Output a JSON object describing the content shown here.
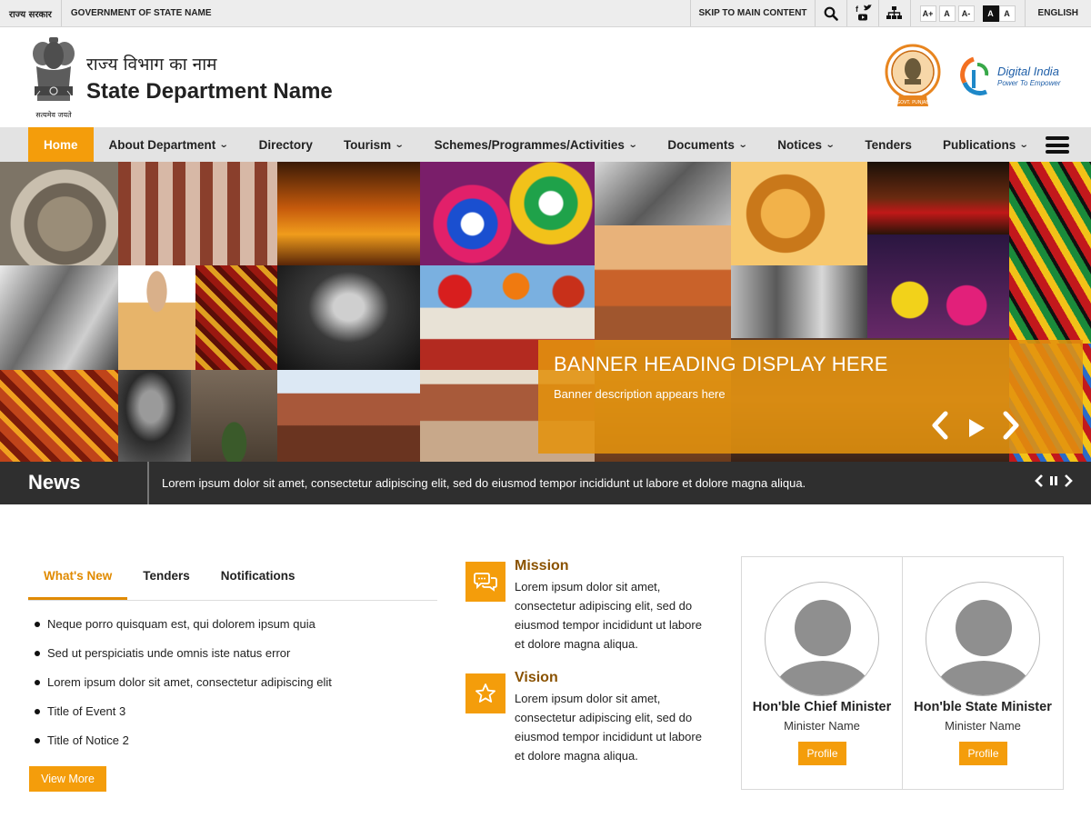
{
  "topbar": {
    "gov_hindi": "राज्य सरकार",
    "gov_name": "GOVERNMENT OF STATE NAME",
    "skip": "SKIP TO MAIN CONTENT",
    "font_sizes": [
      "A+",
      "A",
      "A-"
    ],
    "contrast": [
      "A",
      "A"
    ],
    "language": "ENGLISH",
    "social_icons": [
      "facebook-icon",
      "twitter-icon",
      "youtube-icon"
    ]
  },
  "header": {
    "emblem_caption": "सत्यमेव जयते",
    "dept_hindi": "राज्य विभाग का नाम",
    "dept_name": "State Department Name",
    "seal_caption": "GOVT. PUNJAB",
    "digital_india_title": "Digital India",
    "digital_india_tagline": "Power To Empower"
  },
  "nav": {
    "items": [
      {
        "label": "Home",
        "active": true,
        "dropdown": false
      },
      {
        "label": "About Department",
        "dropdown": true
      },
      {
        "label": "Directory",
        "dropdown": false
      },
      {
        "label": "Tourism",
        "dropdown": true
      },
      {
        "label": "Schemes/Programmes/Activities",
        "dropdown": true
      },
      {
        "label": "Documents",
        "dropdown": true
      },
      {
        "label": "Notices",
        "dropdown": true
      },
      {
        "label": "Tenders",
        "dropdown": false
      },
      {
        "label": "Publications",
        "dropdown": true
      }
    ]
  },
  "banner": {
    "heading": "BANNER HEADING DISPLAY HERE",
    "description": "Banner description appears here"
  },
  "news": {
    "label": "News",
    "ticker": "Lorem ipsum dolor sit amet, consectetur adipiscing elit, sed do eiusmod tempor incididunt ut labore et dolore magna aliqua."
  },
  "tabs": {
    "items": [
      "What's New",
      "Tenders",
      "Notifications"
    ],
    "list": [
      "Neque porro quisquam est, qui dolorem ipsum quia",
      "Sed ut perspiciatis unde omnis iste natus error",
      "Lorem ipsum dolor sit amet, consectetur adipiscing elit",
      "Title of Event 3",
      "Title of Notice 2"
    ],
    "view_more": "View More"
  },
  "mission": {
    "title": "Mission",
    "text": "Lorem ipsum dolor sit amet, consectetur adipiscing elit, sed do eiusmod tempor incididunt ut labore et dolore magna aliqua."
  },
  "vision": {
    "title": "Vision",
    "text": "Lorem ipsum dolor sit amet, consectetur adipiscing elit, sed do eiusmod tempor incididunt ut labore et dolore magna aliqua."
  },
  "ministers": [
    {
      "role": "Hon'ble Chief Minister",
      "name": "Minister Name",
      "button": "Profile"
    },
    {
      "role": "Hon'ble State Minister",
      "name": "Minister Name",
      "button": "Profile"
    }
  ],
  "colors": {
    "accent": "#f49d0b",
    "banner_overlay": "#e2920e",
    "ticker_bg": "#2f2f2f",
    "nav_bg": "#e3e3e3"
  }
}
